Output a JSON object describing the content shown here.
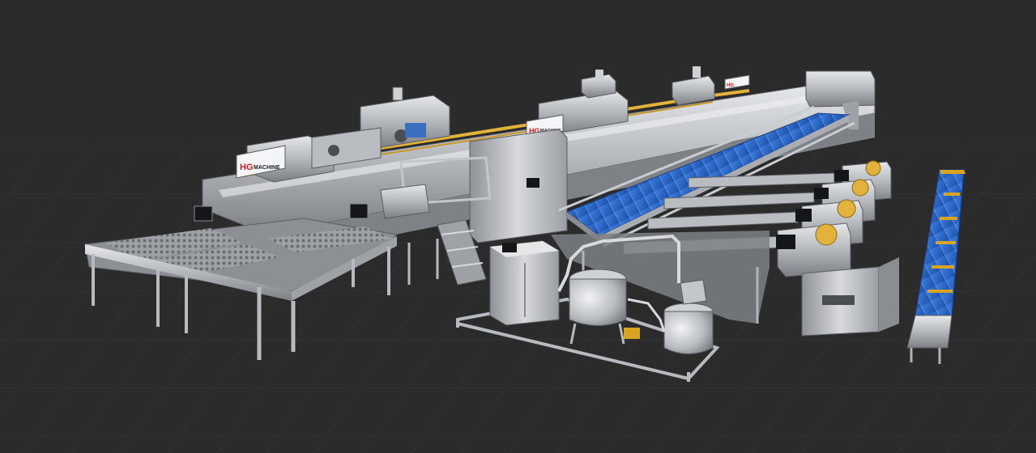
{
  "brand": {
    "logo_mark": "HG",
    "name": "MACHINE"
  },
  "colors": {
    "background": "#2b2b2c",
    "floor_grid": "#353536",
    "steel_light": "#d9dcdf",
    "steel_mid": "#a9adb2",
    "steel_dark": "#6d7176",
    "belt_blue": "#2f6fd6",
    "belt_blue_dark": "#1d4ea3",
    "pipe_yellow": "#e2b23a",
    "roller_yellow": "#d9a420",
    "panel_black": "#151617",
    "logo_red": "#d0202a"
  },
  "icons": {
    "logo": "hg-machine-logo",
    "control_screen": "touch-screen-panel-icon"
  }
}
